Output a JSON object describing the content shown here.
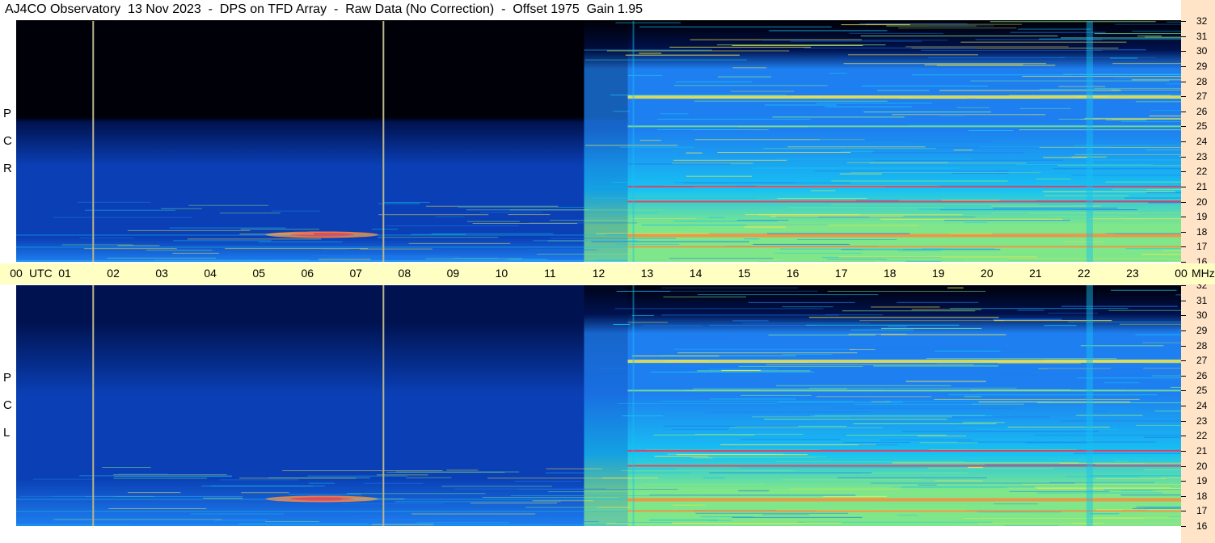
{
  "title": "AJ4CO Observatory  13 Nov 2023  -  DPS on TFD Array  -  Raw Data (No Correction)  -  Offset 1975  Gain 1.95",
  "colors": {
    "background": "#ffffff",
    "time_axis_bg": "#ffffc4",
    "freq_axis_bg": "#ffe4c8",
    "cursor_line": "#b9b38a",
    "colormap": [
      "#000008",
      "#00124f",
      "#0a3fb5",
      "#1e7ff0",
      "#17c2f2",
      "#7fe68a",
      "#f6e84a",
      "#ff8a3c",
      "#ff2e4d"
    ]
  },
  "panels": [
    {
      "id": "rcp",
      "side_label": [
        "P",
        "C",
        "R"
      ]
    },
    {
      "id": "lcp",
      "side_label": [
        "P",
        "C",
        "L"
      ]
    }
  ],
  "time_axis": {
    "utc_label": "UTC",
    "unit_label": "MHz",
    "labels": [
      "00",
      "01",
      "02",
      "03",
      "04",
      "05",
      "06",
      "07",
      "08",
      "09",
      "10",
      "11",
      "12",
      "13",
      "14",
      "15",
      "16",
      "17",
      "18",
      "19",
      "20",
      "21",
      "22",
      "23",
      "00"
    ]
  },
  "freq_axis": {
    "labels": [
      "32",
      "31",
      "30",
      "29",
      "28",
      "27",
      "26",
      "25",
      "24",
      "23",
      "22",
      "21",
      "20",
      "19",
      "18",
      "17",
      "16"
    ]
  },
  "chart_data": {
    "type": "heatmap",
    "title": "AJ4CO Observatory  13 Nov 2023  -  DPS on TFD Array  -  Raw Data (No Correction)  -  Offset 1975  Gain 1.95",
    "xlabel": "UTC",
    "ylabel": "MHz",
    "x_range_utc_hours": [
      0,
      24
    ],
    "y_range_mhz": [
      16,
      32
    ],
    "series": [
      {
        "name": "RCP",
        "side_label": "R C P"
      },
      {
        "name": "LCP",
        "side_label": "L C P"
      }
    ],
    "cursor_lines_utc_hours": [
      1.57,
      7.55
    ],
    "day_transition_utc_hours": [
      11.7,
      12.6
    ],
    "strong_bands_mhz": [
      25.0,
      27.0,
      21.0,
      20.0,
      17.8,
      17.0,
      16.1
    ],
    "spike_times_utc_hours": [
      12.7,
      22.05
    ]
  }
}
